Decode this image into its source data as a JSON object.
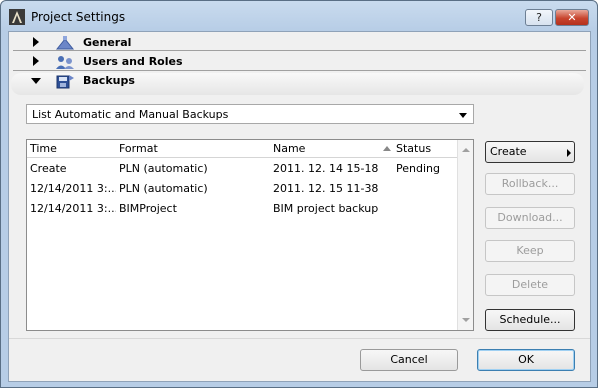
{
  "window": {
    "title": "Project Settings",
    "help_label": "?",
    "close_label": "✕"
  },
  "sections": [
    {
      "label": "General",
      "icon": "general-icon",
      "expanded": false
    },
    {
      "label": "Users and Roles",
      "icon": "users-icon",
      "expanded": false
    },
    {
      "label": "Backups",
      "icon": "backups-icon",
      "expanded": true
    }
  ],
  "backups": {
    "filter_value": "List Automatic and Manual Backups",
    "columns": [
      "Time",
      "Format",
      "Name",
      "Status"
    ],
    "rows": [
      [
        "Create",
        "PLN (automatic)",
        "2011. 12. 14 15-18",
        "Pending"
      ],
      [
        "12/14/2011 3:...",
        "PLN (automatic)",
        "2011. 12. 15 11-38",
        ""
      ],
      [
        "12/14/2011 3:...",
        "BIMProject",
        "BIM project backup",
        ""
      ]
    ]
  },
  "actions": {
    "create": "Create",
    "rollback": "Rollback...",
    "download": "Download...",
    "keep": "Keep",
    "delete": "Delete",
    "schedule": "Schedule..."
  },
  "footer": {
    "cancel": "Cancel",
    "ok": "OK"
  },
  "colors": {
    "accent": "#3c7fb1",
    "close_red": "#c8452e"
  }
}
